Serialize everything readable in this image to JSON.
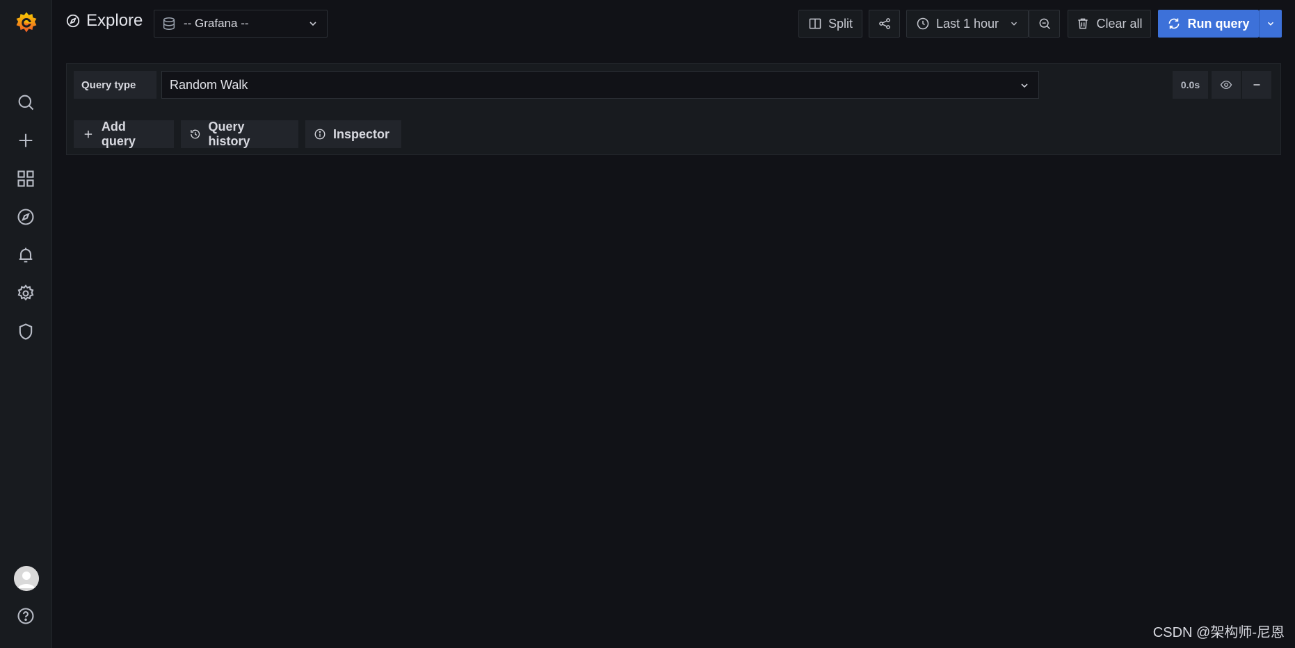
{
  "sidebar": {
    "logo": "grafana-logo",
    "items": [
      {
        "icon": "search-icon"
      },
      {
        "icon": "plus-icon"
      },
      {
        "icon": "dashboards-icon"
      },
      {
        "icon": "explore-icon"
      },
      {
        "icon": "bell-icon"
      },
      {
        "icon": "gear-icon"
      },
      {
        "icon": "shield-icon"
      }
    ],
    "bottom": [
      {
        "icon": "avatar"
      },
      {
        "icon": "help-icon"
      }
    ]
  },
  "header": {
    "title": "Explore",
    "datasource": "-- Grafana --"
  },
  "toolbar": {
    "split_label": "Split",
    "time_range": "Last 1 hour",
    "clear_label": "Clear all",
    "run_label": "Run query"
  },
  "query": {
    "query_type_label": "Query type",
    "query_type_value": "Random Walk",
    "duration": "0.0s"
  },
  "actions": {
    "add_query": "Add query",
    "query_history": "Query history",
    "inspector": "Inspector"
  },
  "watermark": "CSDN @架构师-尼恩",
  "colors": {
    "background": "#111217",
    "panel": "#181b1f",
    "primary": "#3d71d9",
    "logo_orange": "#f46800"
  }
}
